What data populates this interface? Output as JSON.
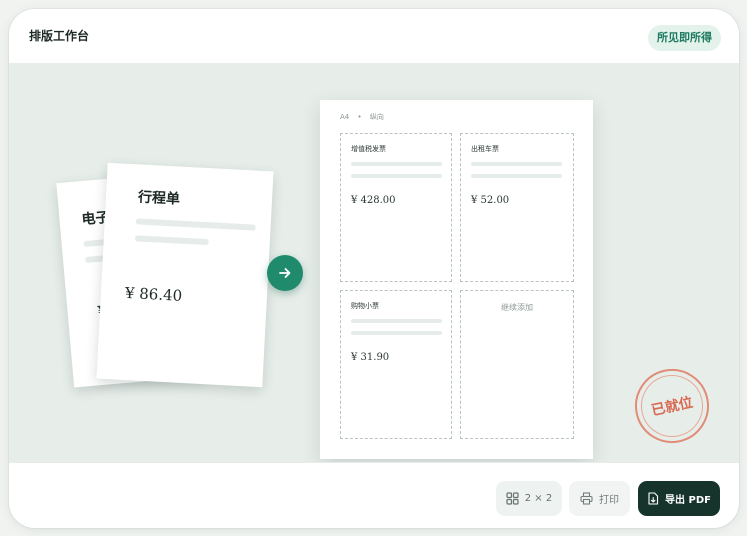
{
  "header": {
    "title": "排版工作台",
    "badge": "所见即所得"
  },
  "source_docs": {
    "back": {
      "title": "电子",
      "price": "¥"
    },
    "front": {
      "title": "行程单",
      "price": "¥ 86.40"
    }
  },
  "sheet": {
    "paper": "A4",
    "orientation": "纵向",
    "cells": [
      {
        "title": "增值税发票",
        "price": "¥ 428.00"
      },
      {
        "title": "出租车票",
        "price": "¥ 52.00"
      },
      {
        "title": "购物小票",
        "price": "¥ 31.90"
      },
      {
        "add_label": "继续添加"
      }
    ]
  },
  "stamp": {
    "text": "已就位"
  },
  "toolbar": {
    "grid_label": "2 × 2",
    "print_label": "打印",
    "export_label": "导出 PDF"
  },
  "icons": {
    "arrow": "arrow-right-icon",
    "grid": "grid-layout-icon",
    "print": "printer-icon",
    "export": "file-download-icon"
  },
  "colors": {
    "accent": "#1f8a6c",
    "badge_text": "#1c7a5f",
    "export_bg": "#17342c",
    "stamp": "#d96a52"
  }
}
